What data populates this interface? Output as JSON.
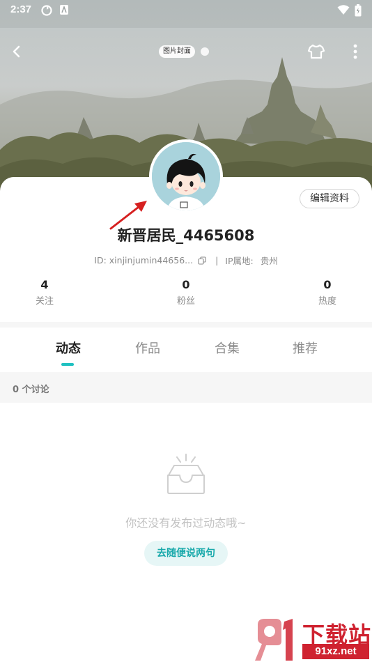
{
  "status_bar": {
    "time": "2:37"
  },
  "header": {
    "cover_tag": "图片封面"
  },
  "profile": {
    "username": "新晋居民_4465608",
    "id_text": "ID: xinjinjumin44656...",
    "separator": "|",
    "ip_label": "IP属地:",
    "ip_value": "贵州",
    "edit_label": "编辑资料"
  },
  "stats": [
    {
      "value": "4",
      "label": "关注"
    },
    {
      "value": "0",
      "label": "粉丝"
    },
    {
      "value": "0",
      "label": "热度"
    }
  ],
  "tabs": [
    {
      "label": "动态",
      "active": true
    },
    {
      "label": "作品",
      "active": false
    },
    {
      "label": "合集",
      "active": false
    },
    {
      "label": "推荐",
      "active": false
    }
  ],
  "discussion": {
    "count_text": "0 个讨论"
  },
  "empty_state": {
    "message": "你还没有发布过动态哦~",
    "button_label": "去随便说两句"
  },
  "watermark": {
    "title": "下载站",
    "url": "91xz.net"
  },
  "colors": {
    "accent": "#1fc1c1",
    "annotation_arrow": "#d62020",
    "watermark": "#cf2230"
  },
  "icons": [
    "back-arrow-icon",
    "shirt-icon",
    "more-vertical-icon",
    "copy-icon",
    "empty-box-icon",
    "wifi-icon",
    "battery-icon"
  ]
}
